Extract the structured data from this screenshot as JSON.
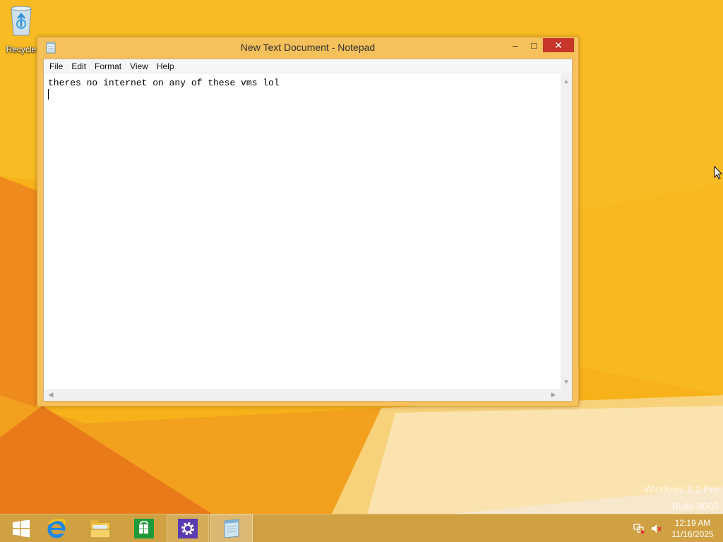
{
  "desktop": {
    "recycle_bin_label": "Recycle",
    "watermark_line1": "Windows 8.1 Pro",
    "watermark_line2": "Build 9600"
  },
  "notepad": {
    "title": "New Text Document - Notepad",
    "controls": {
      "minimize": "–",
      "maximize": "□",
      "close": "✕"
    },
    "menu": [
      {
        "label": "File"
      },
      {
        "label": "Edit"
      },
      {
        "label": "Format"
      },
      {
        "label": "View"
      },
      {
        "label": "Help"
      }
    ],
    "content": "theres no internet on any of these vms lol"
  },
  "taskbar": {
    "pinned": [
      {
        "name": "start-button",
        "icon": "windows-logo-icon"
      },
      {
        "name": "internet-explorer",
        "icon": "ie-icon"
      },
      {
        "name": "file-explorer",
        "icon": "folder-icon"
      },
      {
        "name": "store",
        "icon": "store-icon"
      },
      {
        "name": "settings",
        "icon": "gear-icon"
      },
      {
        "name": "notepad",
        "icon": "notepad-icon"
      }
    ],
    "tray": {
      "time": "12:19 AM",
      "date": "11/16/2025"
    }
  },
  "colors": {
    "wallpaper_base": "#f7b21a",
    "wallpaper_dark": "#e9741b",
    "close_button": "#c7352b",
    "window_frame": "#f6c05a"
  }
}
